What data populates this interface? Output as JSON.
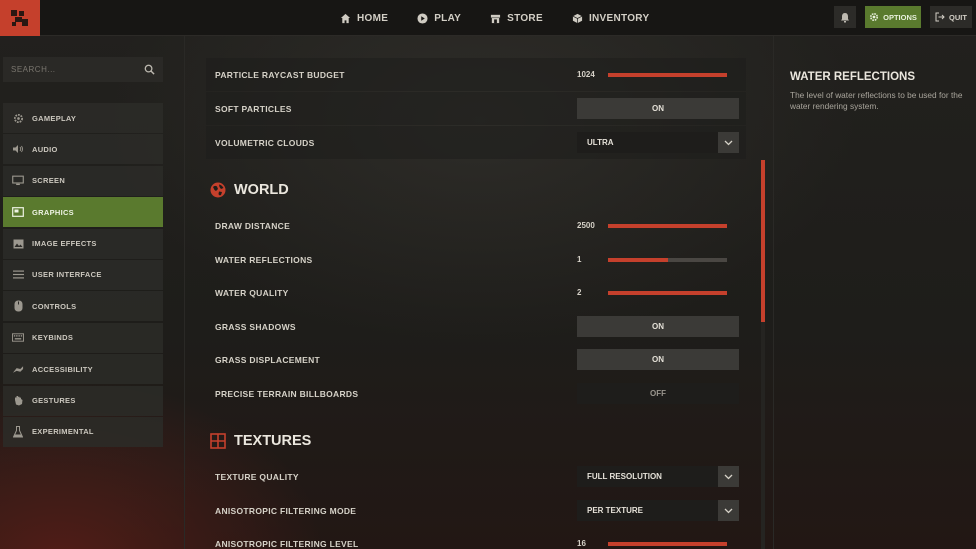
{
  "nav": {
    "items": [
      {
        "label": "HOME",
        "icon": "home-icon"
      },
      {
        "label": "PLAY",
        "icon": "play-icon"
      },
      {
        "label": "STORE",
        "icon": "store-icon"
      },
      {
        "label": "INVENTORY",
        "icon": "inventory-icon"
      }
    ],
    "options_label": "OPTIONS",
    "quit_label": "QUIT"
  },
  "search": {
    "placeholder": "SEARCH..."
  },
  "sidebar": {
    "items": [
      {
        "label": "GAMEPLAY",
        "icon": "gear-icon"
      },
      {
        "label": "AUDIO",
        "icon": "speaker-icon"
      },
      {
        "label": "SCREEN",
        "icon": "monitor-icon"
      },
      {
        "label": "GRAPHICS",
        "icon": "graphics-icon",
        "active": true
      },
      {
        "label": "IMAGE EFFECTS",
        "icon": "image-icon"
      },
      {
        "label": "USER INTERFACE",
        "icon": "list-icon"
      },
      {
        "label": "CONTROLS",
        "icon": "mouse-icon"
      },
      {
        "label": "KEYBINDS",
        "icon": "keyboard-icon"
      },
      {
        "label": "ACCESSIBILITY",
        "icon": "accessibility-icon"
      },
      {
        "label": "GESTURES",
        "icon": "hand-icon"
      },
      {
        "label": "EXPERIMENTAL",
        "icon": "flask-icon"
      }
    ]
  },
  "settings": {
    "particle_raycast": {
      "label": "PARTICLE RAYCAST BUDGET",
      "value": "1024",
      "fraction": 1.0
    },
    "soft_particles": {
      "label": "SOFT PARTICLES",
      "value": "ON"
    },
    "volumetric_clouds": {
      "label": "VOLUMETRIC CLOUDS",
      "value": "ULTRA"
    },
    "world": {
      "title": "WORLD",
      "draw_distance": {
        "label": "DRAW DISTANCE",
        "value": "2500",
        "fraction": 1.0
      },
      "water_reflections": {
        "label": "WATER REFLECTIONS",
        "value": "1",
        "fraction": 0.5
      },
      "water_quality": {
        "label": "WATER QUALITY",
        "value": "2",
        "fraction": 1.0
      },
      "grass_shadows": {
        "label": "GRASS SHADOWS",
        "value": "ON"
      },
      "grass_displacement": {
        "label": "GRASS DISPLACEMENT",
        "value": "ON"
      },
      "precise_terrain": {
        "label": "PRECISE TERRAIN BILLBOARDS",
        "value": "OFF"
      }
    },
    "textures": {
      "title": "TEXTURES",
      "texture_quality": {
        "label": "TEXTURE QUALITY",
        "value": "FULL RESOLUTION"
      },
      "aniso_mode": {
        "label": "ANISOTROPIC FILTERING MODE",
        "value": "PER TEXTURE"
      },
      "aniso_level": {
        "label": "ANISOTROPIC FILTERING LEVEL",
        "value": "16",
        "fraction": 1.0
      }
    }
  },
  "info": {
    "title": "WATER REFLECTIONS",
    "description": "The level of water reflections to be used for the water rendering system."
  },
  "colors": {
    "accent_red": "#c5402c",
    "accent_green": "#5a7a2e"
  }
}
